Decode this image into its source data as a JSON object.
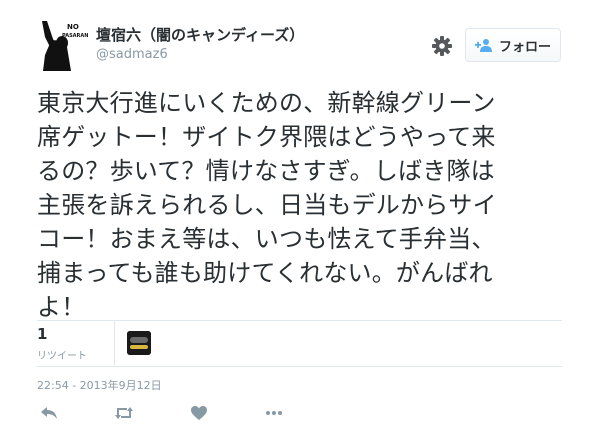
{
  "tweet": {
    "author": {
      "display_name": "壇宿六（闇のキャンディーズ）",
      "handle": "@sadmaz6",
      "avatar_icon": "no-pasaran-avatar-icon",
      "avatar_text_line1": "NO",
      "avatar_text_line2": "PASARAN"
    },
    "follow_label": "フォロー",
    "text_lines": [
      "東京大行進にいくための、新幹線グリーン",
      "席ゲットー！ザイトク界隈はどうやって来",
      "るの？歩いて？情けなさすぎ。しばき隊は",
      "主張を訴えられるし、日当もデルからサイ",
      "コー！おまえ等は、いつも怯えて手弁当、",
      "捕まっても誰も助けてくれない。がんばれ",
      "よ！"
    ],
    "retweet_count": "1",
    "retweet_label": "リツイート",
    "timestamp": "22:54 - 2013年9月12日"
  },
  "colors": {
    "text": "#292f33",
    "muted": "#8899a6",
    "border": "#e1e8ed",
    "icon": "#8899a6",
    "accent": "#55acee"
  }
}
